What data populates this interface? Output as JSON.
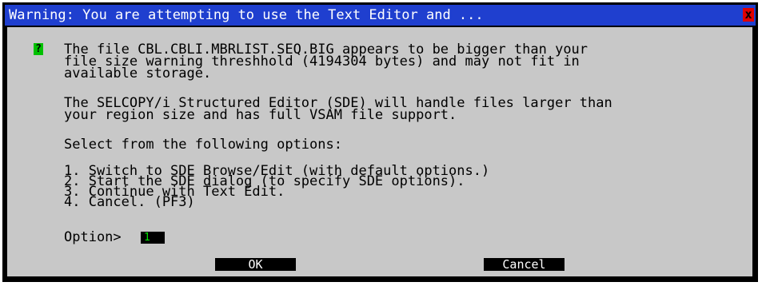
{
  "dialog": {
    "title": "Warning: You are attempting to use the Text Editor and ...",
    "close_glyph": "x",
    "question_glyph": "?",
    "paragraph1": "The file CBL.CBLI.MBRLIST.SEQ.BIG appears to be bigger than your\nfile size warning threshhold (4194304 bytes) and may not fit in\navailable storage.",
    "paragraph2": "The SELCOPY/i Structured Editor (SDE) will handle files larger than\nyour region size and has full VSAM file support.",
    "prompt": "Select from the following options:",
    "options": [
      "1. Switch to SDE Browse/Edit (with default options.)",
      "2. Start the SDE dialog (to specify SDE options).",
      "3. Continue with Text Edit.",
      "4. Cancel. (PF3)"
    ],
    "option_label": "Option>",
    "option_value": "1",
    "ok_label": "OK",
    "cancel_label": "Cancel"
  },
  "colors": {
    "titlebar": "#1f3fcf",
    "panel": "#c8c8c8",
    "question_icon": "#00c000",
    "close": "#e00000"
  }
}
